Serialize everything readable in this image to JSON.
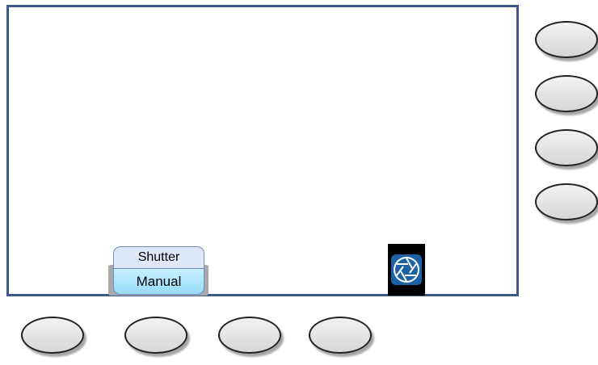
{
  "screen": {
    "shutter_label": "Shutter",
    "shutter_value": "Manual",
    "aperture_icon": "aperture-icon"
  },
  "colors": {
    "screen_border": "#3b5a8a",
    "shutter_top": "#dfe8fb",
    "shutter_bottom": "#96dcfb",
    "aperture_blue": "#1e62a6"
  },
  "softkeys": {
    "right_count": 4,
    "bottom_count": 4
  }
}
